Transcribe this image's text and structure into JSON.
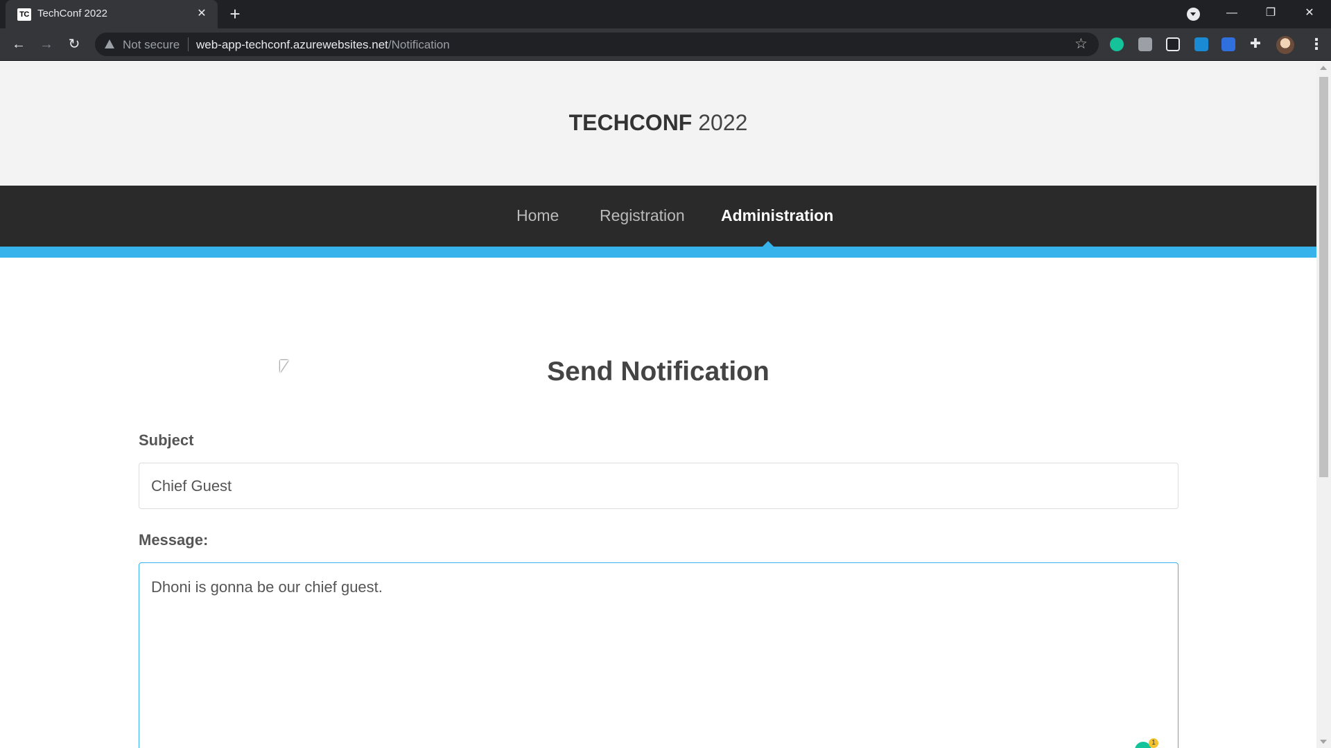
{
  "browser": {
    "tab_title": "TechConf 2022",
    "tab_favicon_text": "TC",
    "security_text": "Not secure",
    "url_host": "web-app-techconf.azurewebsites.net",
    "url_path": "/Notification"
  },
  "site": {
    "brand_bold": "TECHCONF",
    "brand_year": "2022",
    "nav": [
      {
        "label": "Home",
        "active": false
      },
      {
        "label": "Registration",
        "active": false
      },
      {
        "label": "Administration",
        "active": true
      }
    ],
    "accent_color": "#37b3ec"
  },
  "form": {
    "heading": "Send Notification",
    "subject_label": "Subject",
    "subject_value": "Chief Guest",
    "message_label": "Message:",
    "message_value": "Dhoni is gonna be our chief guest."
  },
  "grammarly": {
    "count": "1"
  }
}
